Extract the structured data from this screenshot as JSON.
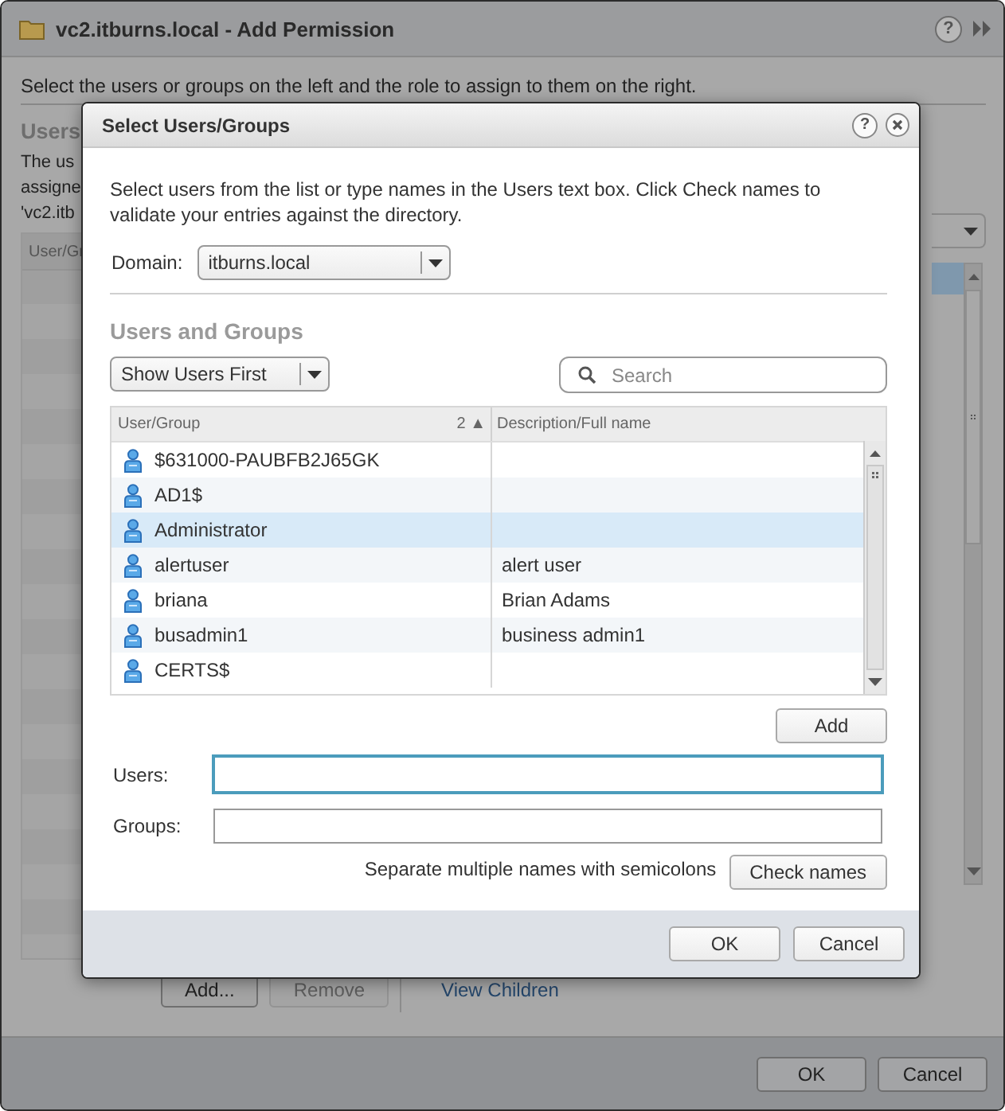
{
  "window": {
    "title": "vc2.itburns.local - Add Permission",
    "help": "?",
    "instructions": "Select the users or groups on the left and the role to assign to them on the right.",
    "section_heading": "Users",
    "description_lines": [
      "The us",
      "assigne",
      "'vc2.itb"
    ],
    "table": {
      "columns": [
        "User/Gr"
      ]
    },
    "buttons": [
      {
        "label": "Add...",
        "disabled": false
      },
      {
        "label": "Remove",
        "disabled": true
      }
    ],
    "link": "View Children",
    "footer_buttons": [
      "OK",
      "Cancel"
    ]
  },
  "dialog": {
    "title": "Select Users/Groups",
    "help": "?",
    "intro": "Select users from the list or type names in the Users text box. Click Check names to validate your entries against the directory.",
    "domain": {
      "label": "Domain:",
      "value": "itburns.local"
    },
    "heading": "Users and Groups",
    "sort_menu": {
      "value": "Show Users First"
    },
    "search": {
      "placeholder": "Search"
    },
    "table": {
      "columns": [
        {
          "label": "User/Group",
          "sort": "2 ▲"
        },
        {
          "label": "Description/Full name"
        }
      ],
      "rows": [
        {
          "name": "$631000-PAUBFB2J65GK",
          "selected": false
        },
        {
          "name": "AD1$",
          "selected": false
        },
        {
          "name": "Administrator",
          "selected": true
        },
        {
          "name": "alertuser",
          "description": "alert user",
          "selected": false
        },
        {
          "name": "briana",
          "description": "Brian Adams",
          "selected": false
        },
        {
          "name": "busadmin1",
          "description": "business admin1",
          "selected": false
        },
        {
          "name": "CERTS$",
          "selected": false
        }
      ]
    },
    "add_button": "Add",
    "users": {
      "label": "Users:",
      "focused": true
    },
    "groups": {
      "label": "Groups:",
      "focused": false
    },
    "hint": "Separate multiple names with semicolons",
    "check_button": "Check names",
    "footer_buttons": [
      "OK",
      "Cancel"
    ]
  }
}
